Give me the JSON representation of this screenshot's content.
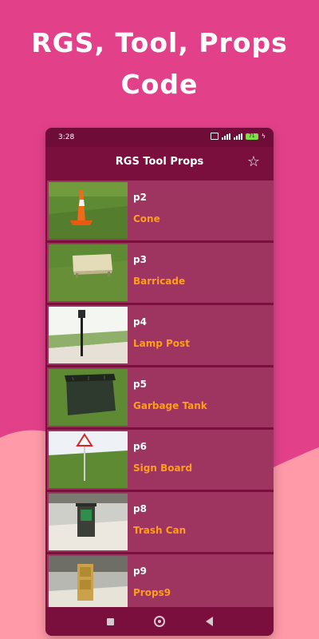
{
  "promo": {
    "headline_line1": "RGS, Tool, Props",
    "headline_line2": "Code"
  },
  "status_bar": {
    "time": "3:28",
    "battery": "71"
  },
  "app_bar": {
    "title": "RGS Tool Props",
    "action_icon": "star-outline-icon"
  },
  "items": [
    {
      "code": "p2",
      "name": "Cone"
    },
    {
      "code": "p3",
      "name": "Barricade"
    },
    {
      "code": "p4",
      "name": "Lamp Post"
    },
    {
      "code": "p5",
      "name": "Garbage Tank"
    },
    {
      "code": "p6",
      "name": "Sign Board"
    },
    {
      "code": "p8",
      "name": "Trash Can"
    },
    {
      "code": "p9",
      "name": "Props9"
    }
  ],
  "nav_bar": {
    "buttons": [
      "recents-icon",
      "home-icon",
      "back-icon"
    ]
  },
  "colors": {
    "background": "#e2418a",
    "wave": "#ff9aa8",
    "app_bar": "#7a0f3e",
    "list_item": "#9e3560",
    "item_name": "#ff9e1a"
  }
}
